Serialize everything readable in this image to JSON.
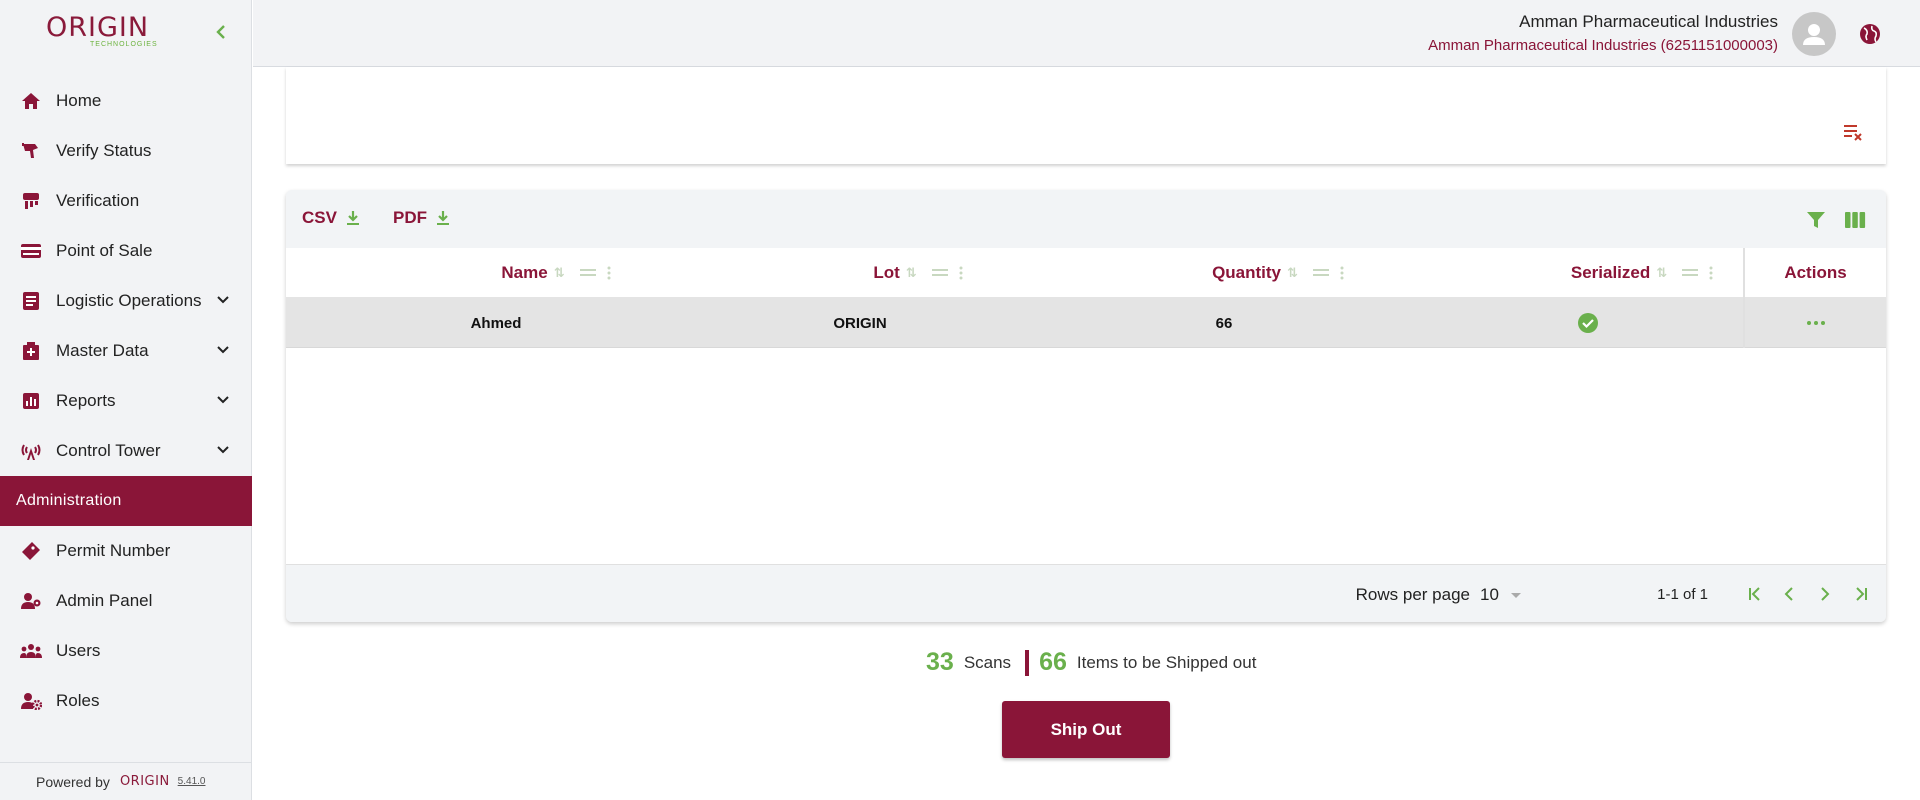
{
  "sidebar": {
    "logo_text": "ORIGIN",
    "logo_subtext": "TECHNOLOGIES",
    "items": [
      {
        "label": "Home",
        "icon": "home-icon"
      },
      {
        "label": "Verify Status",
        "icon": "scanner-icon"
      },
      {
        "label": "Verification",
        "icon": "verification-icon"
      },
      {
        "label": "Point of Sale",
        "icon": "credit-card-icon"
      },
      {
        "label": "Logistic Operations",
        "icon": "document-icon",
        "expandable": true
      },
      {
        "label": "Master Data",
        "icon": "medical-box-icon",
        "expandable": true
      },
      {
        "label": "Reports",
        "icon": "bar-chart-icon",
        "expandable": true
      },
      {
        "label": "Control Tower",
        "icon": "tower-icon",
        "expandable": true
      }
    ],
    "section_label": "Administration",
    "admin_items": [
      {
        "label": "Permit Number",
        "icon": "tag-icon"
      },
      {
        "label": "Admin Panel",
        "icon": "admin-user-icon"
      },
      {
        "label": "Users",
        "icon": "users-icon"
      },
      {
        "label": "Roles",
        "icon": "user-gear-icon"
      }
    ],
    "powered_by": "Powered by",
    "powered_logo": "ORIGIN",
    "version": "5.41.0"
  },
  "header": {
    "org_name": "Amman Pharmaceutical Industries",
    "org_id": "Amman Pharmaceutical Industries (6251151000003)"
  },
  "toolbar": {
    "csv_label": "CSV",
    "pdf_label": "PDF"
  },
  "table": {
    "columns": [
      "Name",
      "Lot",
      "Quantity",
      "Serialized"
    ],
    "actions_label": "Actions",
    "rows": [
      {
        "name": "Ahmed",
        "lot": "ORIGIN",
        "quantity": "66",
        "serialized": true
      }
    ]
  },
  "pagination": {
    "rows_per_page_label": "Rows per page",
    "rows_per_page": "10",
    "range": "1-1 of 1"
  },
  "summary": {
    "scans_count": "33",
    "scans_label": "Scans",
    "items_count": "66",
    "items_label": "Items to be Shipped out"
  },
  "ship_out_label": "Ship Out",
  "colors": {
    "brand": "#8a1538",
    "accent_green": "#6ab04c",
    "sidebar_bg": "#f2f3f5"
  }
}
